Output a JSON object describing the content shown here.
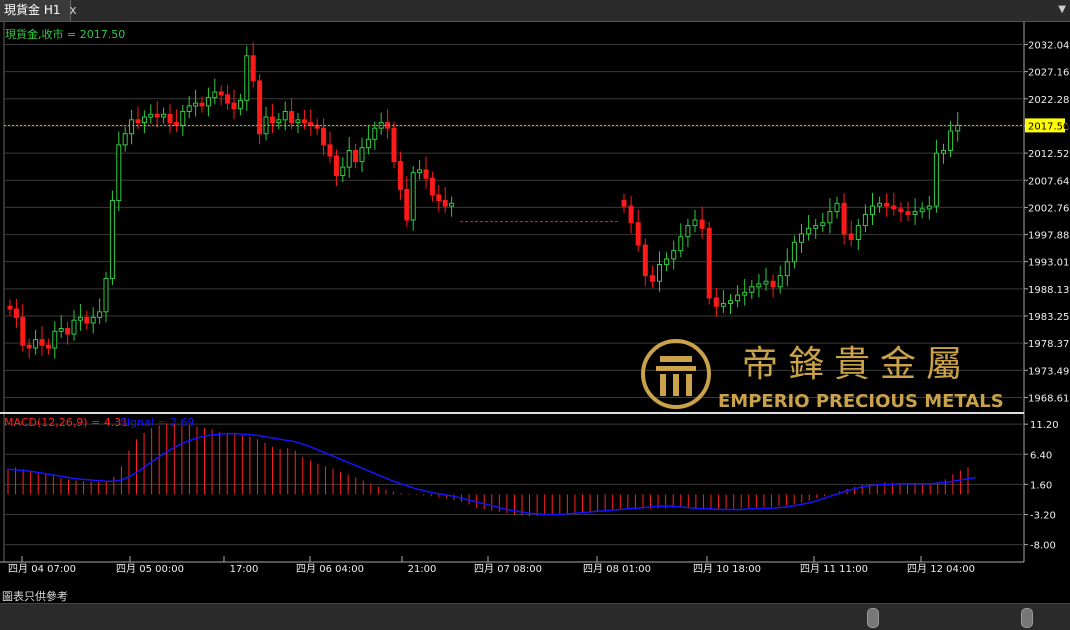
{
  "window": {
    "tab_title": "現貨金 H1",
    "close_glyph": "x",
    "menu_glyph": "▼"
  },
  "footer": {
    "note": "圖表只供參考"
  },
  "watermark": {
    "chinese": "帝鋒貴金屬",
    "english": "EMPERIO PRECIOUS METALS",
    "gold": "#c9a24a"
  },
  "colors": {
    "up": "#2ecc40",
    "down": "#ff1a1a",
    "grid": "#3a3a3a",
    "price_line": "#ff9900",
    "macd_hist": "#ff2020",
    "signal": "#1414ff"
  },
  "chart_data": [
    {
      "type": "candlestick",
      "title": "現貨金,收市 = 2017.50",
      "last_price": 2017.5,
      "last_price_label": "2017.50",
      "ylim": [
        1966.0,
        2035.0
      ],
      "y_ticks": [
        "2032.04",
        "2027.16",
        "2022.28",
        "2017.40",
        "2012.52",
        "2007.64",
        "2002.76",
        "1997.88",
        "1993.01",
        "1988.13",
        "1983.25",
        "1978.37",
        "1973.49",
        "1968.61"
      ],
      "x_ticks": [
        "四月 04 07:00",
        "四月 05 00:00",
        "17:00",
        "四月 06 04:00",
        "21:00",
        "四月 07 08:00",
        "四月 08 01:00",
        "四月 10 18:00",
        "四月 11 11:00",
        "四月 12 04:00"
      ],
      "series_close": [
        1984.5,
        1983.0,
        1978.0,
        1977.5,
        1979.0,
        1978.0,
        1977.5,
        1980.5,
        1981.0,
        1980.0,
        1982.5,
        1983.0,
        1982.0,
        1983.0,
        1984.0,
        1990.0,
        2004.0,
        2014.0,
        2016.0,
        2018.5,
        2018.0,
        2019.0,
        2019.5,
        2019.0,
        2019.5,
        2018.0,
        2017.5,
        2020.0,
        2021.0,
        2021.5,
        2021.0,
        2022.5,
        2023.5,
        2023.0,
        2021.5,
        2020.5,
        2022.0,
        2030.0,
        2025.5,
        2016.0,
        2019.0,
        2018.0,
        2018.5,
        2020.0,
        2018.0,
        2018.5,
        2018.0,
        2017.5,
        2017.0,
        2014.0,
        2012.0,
        2008.5,
        2010.0,
        2013.0,
        2011.0,
        2013.5,
        2015.0,
        2017.0,
        2018.0,
        2017.0,
        2011.0,
        2006.0,
        2000.5,
        2009.0,
        2009.5,
        2008.0,
        2005.0,
        2004.0,
        2003.0,
        2003.5
      ],
      "series_close_2": [
        2003.0,
        2000.0,
        1996.0,
        1990.5,
        1989.5,
        1992.5,
        1993.5,
        1995.0,
        1997.5,
        1999.5,
        2000.5,
        1999.0,
        1986.5,
        1985.0,
        1985.5,
        1986.0,
        1987.0,
        1987.5,
        1988.5,
        1989.0,
        1989.5,
        1988.5,
        1990.5,
        1993.0,
        1996.5,
        1998.0,
        1999.0,
        1999.5,
        2000.0,
        2002.0,
        2003.5,
        1998.0,
        1997.0,
        1999.5,
        2001.5,
        2003.0,
        2003.5,
        2003.0,
        2002.5,
        2002.0,
        2001.5,
        2002.0,
        2002.5,
        2003.0,
        2012.5,
        2013.0,
        2016.5,
        2017.5
      ]
    },
    {
      "type": "bar",
      "title": "MACD(12,26,9) = 4.31",
      "signal_label": "Signal = 2.69",
      "ylim": [
        -9.5,
        12.5
      ],
      "y_ticks": [
        "11.20",
        "6.40",
        "1.60",
        "-3.20",
        "-8.00"
      ],
      "macd_values": [
        4.1,
        4.3,
        4.0,
        3.8,
        3.5,
        3.2,
        3.0,
        2.6,
        2.4,
        2.2,
        2.1,
        2.0,
        2.0,
        2.2,
        2.8,
        4.5,
        7.0,
        8.8,
        9.8,
        10.6,
        11.0,
        11.3,
        11.2,
        11.0,
        11.0,
        10.8,
        10.6,
        10.4,
        10.0,
        9.8,
        9.6,
        9.4,
        9.2,
        8.8,
        8.2,
        7.6,
        7.2,
        7.4,
        7.0,
        6.0,
        5.4,
        4.9,
        4.5,
        4.1,
        3.6,
        3.2,
        2.7,
        2.2,
        1.7,
        1.2,
        0.8,
        0.4,
        0.2,
        0.1,
        -0.1,
        -0.2,
        -0.3,
        -0.4,
        -0.6,
        -0.9,
        -1.2,
        -1.6,
        -2.2,
        -2.4,
        -2.6,
        -2.8,
        -3.0,
        -3.2,
        -3.4,
        -3.5,
        -3.4,
        -3.3,
        -3.2,
        -3.1,
        -3.0,
        -3.0,
        -2.9,
        -2.8,
        -2.7,
        -2.6,
        -2.6,
        -2.5,
        -2.4,
        -2.4,
        -2.3,
        -2.3,
        -2.2,
        -2.2,
        -2.1,
        -2.1,
        -2.2,
        -2.4,
        -2.4,
        -2.5,
        -2.4,
        -2.4,
        -2.3,
        -2.2,
        -2.2,
        -2.1,
        -2.0,
        -2.0,
        -1.9,
        -1.8,
        -1.6,
        -1.3,
        -1.0,
        -0.6,
        -0.3,
        0.1,
        0.5,
        0.9,
        1.2,
        1.5,
        1.6,
        1.7,
        1.9,
        1.9,
        1.8,
        1.8,
        1.7,
        1.7,
        1.8,
        2.0,
        2.4,
        3.2,
        3.8,
        4.31
      ],
      "signal_values": [
        4.0,
        3.9,
        3.8,
        3.7,
        3.5,
        3.3,
        3.1,
        2.9,
        2.7,
        2.5,
        2.4,
        2.3,
        2.2,
        2.1,
        2.1,
        2.3,
        2.8,
        3.5,
        4.3,
        5.2,
        6.0,
        6.8,
        7.5,
        8.1,
        8.6,
        9.0,
        9.3,
        9.5,
        9.6,
        9.7,
        9.7,
        9.6,
        9.5,
        9.4,
        9.2,
        9.0,
        8.8,
        8.6,
        8.4,
        8.0,
        7.6,
        7.1,
        6.6,
        6.1,
        5.6,
        5.1,
        4.6,
        4.1,
        3.6,
        3.1,
        2.6,
        2.1,
        1.7,
        1.3,
        0.9,
        0.6,
        0.3,
        0.1,
        -0.1,
        -0.3,
        -0.6,
        -0.9,
        -1.2,
        -1.5,
        -1.8,
        -2.1,
        -2.4,
        -2.6,
        -2.8,
        -3.0,
        -3.1,
        -3.2,
        -3.2,
        -3.2,
        -3.1,
        -3.0,
        -2.9,
        -2.8,
        -2.7,
        -2.6,
        -2.5,
        -2.4,
        -2.3,
        -2.2,
        -2.1,
        -2.0,
        -1.9,
        -1.9,
        -1.9,
        -2.0,
        -2.1,
        -2.2,
        -2.3,
        -2.3,
        -2.4,
        -2.4,
        -2.4,
        -2.4,
        -2.3,
        -2.3,
        -2.2,
        -2.2,
        -2.1,
        -2.0,
        -1.8,
        -1.6,
        -1.3,
        -1.0,
        -0.6,
        -0.2,
        0.2,
        0.6,
        0.9,
        1.2,
        1.4,
        1.5,
        1.6,
        1.6,
        1.7,
        1.7,
        1.7,
        1.7,
        1.7,
        1.8,
        1.9,
        2.1,
        2.3,
        2.5,
        2.69
      ]
    }
  ]
}
